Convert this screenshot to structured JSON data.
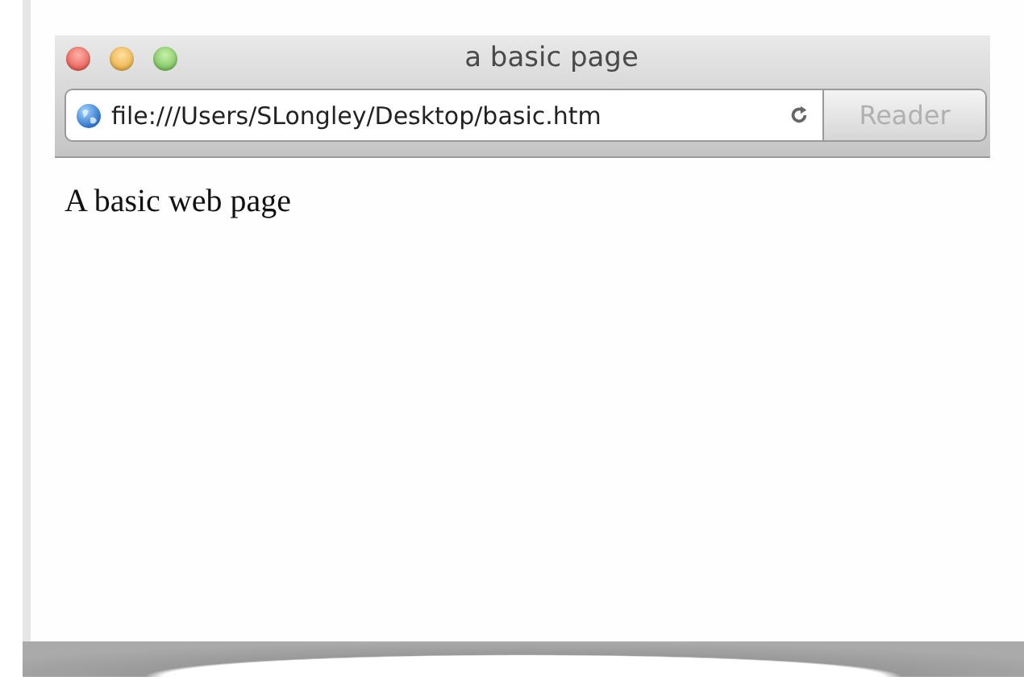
{
  "window": {
    "title": "a basic page"
  },
  "address_bar": {
    "value": "file:///Users/SLongley/Desktop/basic.htm"
  },
  "reader_button": {
    "label": "Reader",
    "disabled": true
  },
  "page": {
    "text": "A basic web page"
  }
}
